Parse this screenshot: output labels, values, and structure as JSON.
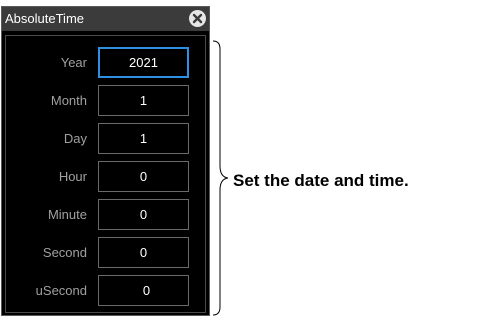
{
  "dialog": {
    "title": "AbsoluteTime",
    "close_icon": "close-icon"
  },
  "fields": [
    {
      "label": "Year",
      "value": "2021"
    },
    {
      "label": "Month",
      "value": "1"
    },
    {
      "label": "Day",
      "value": "1"
    },
    {
      "label": "Hour",
      "value": "0"
    },
    {
      "label": "Minute",
      "value": "0"
    },
    {
      "label": "Second",
      "value": "0"
    },
    {
      "label": "uSecond",
      "value": "0"
    }
  ],
  "annotation": {
    "text": "Set the date and time."
  },
  "colors": {
    "focus_border": "#2f8fe0",
    "label_text": "#a0a0a0",
    "field_border": "#6a6a6a",
    "background": "#000000"
  }
}
